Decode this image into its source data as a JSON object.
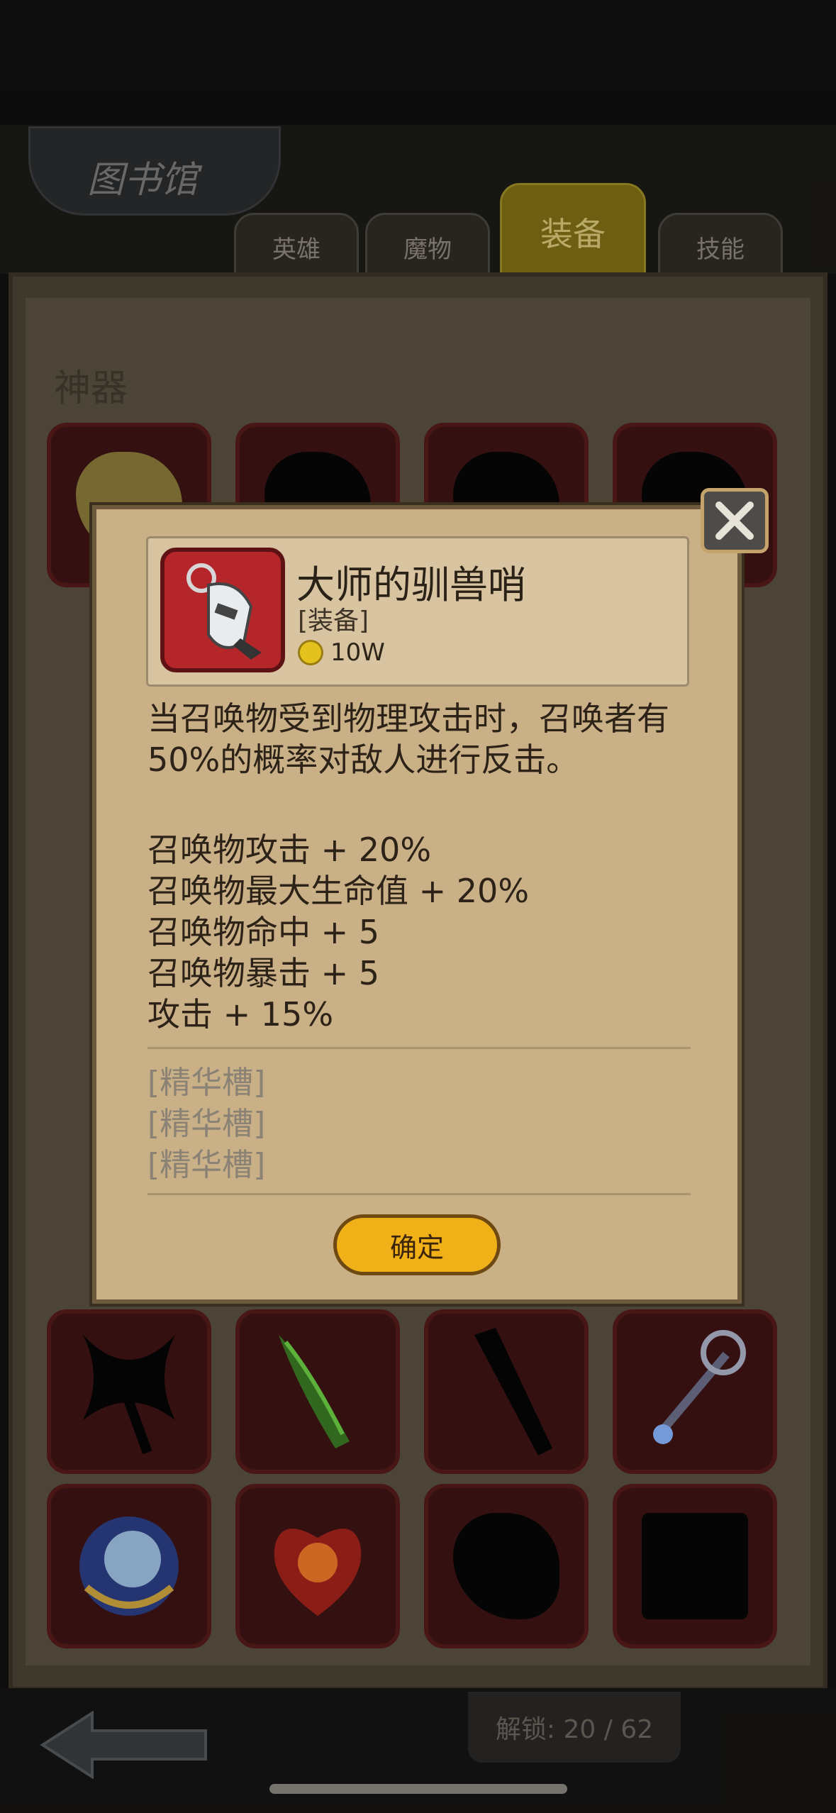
{
  "header": {
    "title": "图书馆",
    "tabs": [
      {
        "label": "英雄",
        "active": false
      },
      {
        "label": "魔物",
        "active": false
      },
      {
        "label": "装备",
        "active": true
      },
      {
        "label": "技能",
        "active": false
      }
    ]
  },
  "section": {
    "title": "神器"
  },
  "footer": {
    "unlock": "解锁: 20 / 62"
  },
  "dialog": {
    "item_name": "大师的驯兽哨",
    "item_type": "[装备]",
    "price": "10W",
    "description": "当召唤物受到物理攻击时，召唤者有50%的概率对敌人进行反击。",
    "stats": [
      "召唤物攻击 + 20%",
      "召唤物最大生命值 + 20%",
      "召唤物命中 + 5",
      "召唤物暴击 + 5",
      "攻击 + 15%"
    ],
    "essence_slots": [
      "[精华槽]",
      "[精华槽]",
      "[精华槽]"
    ],
    "confirm_label": "确定"
  },
  "colors": {
    "accent_gold": "#f0b018",
    "slot_red": "#3e1413",
    "dialog_bg": "#c9b086"
  }
}
